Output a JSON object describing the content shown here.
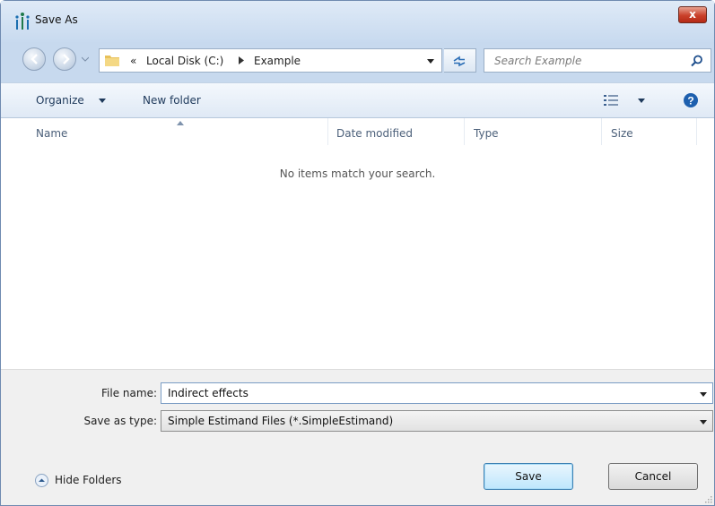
{
  "window": {
    "title": "Save As",
    "close_label": "x"
  },
  "address": {
    "overflow": "«",
    "segments": [
      "Local Disk (C:)",
      "Example"
    ]
  },
  "search": {
    "placeholder": "Search Example"
  },
  "toolbar": {
    "organize_label": "Organize",
    "new_folder_label": "New folder"
  },
  "file_list": {
    "columns": [
      "Name",
      "Date modified",
      "Type",
      "Size"
    ],
    "sorted_column": "Name",
    "empty_message": "No items match your search."
  },
  "form": {
    "filename_label": "File name:",
    "filename_value": "Indirect effects",
    "savetype_label": "Save as type:",
    "savetype_value": "Simple Estimand Files (*.SimpleEstimand)"
  },
  "footer": {
    "hide_folders_label": "Hide Folders",
    "save_label": "Save",
    "cancel_label": "Cancel"
  },
  "icons": {
    "app": "app-icon",
    "back": "back-arrow-icon",
    "forward": "forward-arrow-icon",
    "folder": "folder-icon",
    "refresh": "refresh-icon",
    "search": "search-icon",
    "views": "views-icon",
    "help": "help-icon",
    "hide_folders": "chevron-up-icon"
  }
}
